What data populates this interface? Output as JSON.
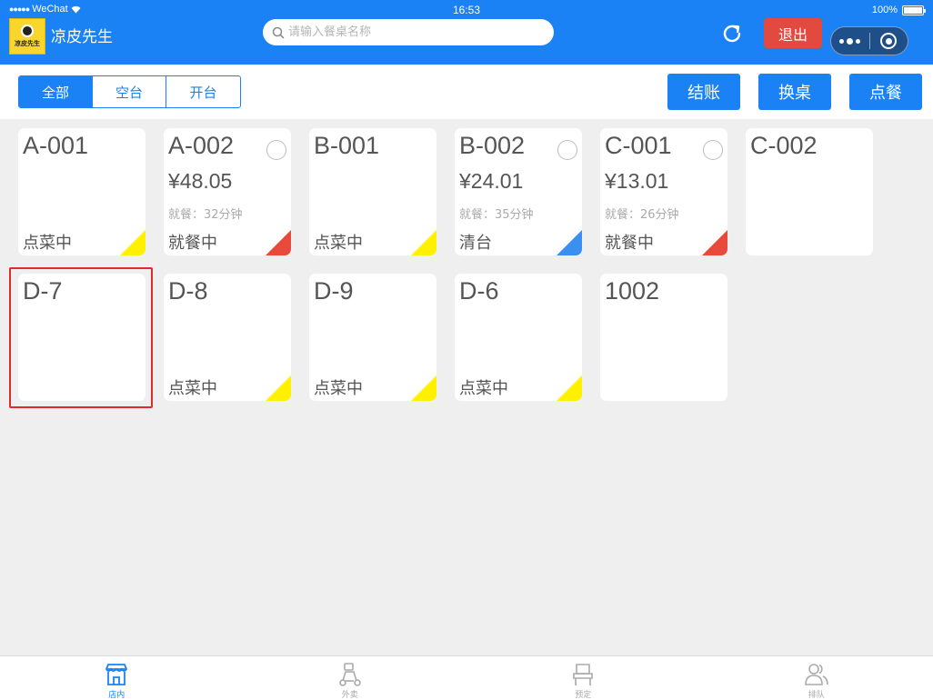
{
  "status_bar": {
    "carrier": "WeChat",
    "time": "16:53",
    "battery": "100%"
  },
  "header": {
    "shop_name": "凉皮先生",
    "logo_text": "凉皮先生",
    "search_placeholder": "请输入餐桌名称",
    "logout_label": "退出"
  },
  "toolbar": {
    "filters": [
      {
        "label": "全部",
        "active": true
      },
      {
        "label": "空台",
        "active": false
      },
      {
        "label": "开台",
        "active": false
      }
    ],
    "actions": [
      "结账",
      "换桌",
      "点餐"
    ]
  },
  "status_colors": {
    "点菜中": "#ffef00",
    "就餐中": "#e84a3c",
    "清台": "#3a8ff0"
  },
  "tables": [
    {
      "name": "A-001",
      "price": "",
      "duration": "",
      "status": "点菜中",
      "radio": false
    },
    {
      "name": "A-002",
      "price": "¥48.05",
      "duration": "就餐：32分钟",
      "status": "就餐中",
      "radio": true
    },
    {
      "name": "B-001",
      "price": "",
      "duration": "",
      "status": "点菜中",
      "radio": false
    },
    {
      "name": "B-002",
      "price": "¥24.01",
      "duration": "就餐：35分钟",
      "status": "清台",
      "radio": true
    },
    {
      "name": "C-001",
      "price": "¥13.01",
      "duration": "就餐：26分钟",
      "status": "就餐中",
      "radio": true
    },
    {
      "name": "C-002",
      "price": "",
      "duration": "",
      "status": "",
      "radio": false
    },
    {
      "name": "D-7",
      "price": "",
      "duration": "",
      "status": "",
      "radio": false,
      "selected": true
    },
    {
      "name": "D-8",
      "price": "",
      "duration": "",
      "status": "点菜中",
      "radio": false
    },
    {
      "name": "D-9",
      "price": "",
      "duration": "",
      "status": "点菜中",
      "radio": false
    },
    {
      "name": "D-6",
      "price": "",
      "duration": "",
      "status": "点菜中",
      "radio": false
    },
    {
      "name": "1002",
      "price": "",
      "duration": "",
      "status": "",
      "radio": false
    }
  ],
  "tabbar": [
    {
      "label": "店内",
      "icon": "store-icon",
      "active": true
    },
    {
      "label": "外卖",
      "icon": "scooter-icon",
      "active": false
    },
    {
      "label": "预定",
      "icon": "chair-icon",
      "active": false
    },
    {
      "label": "排队",
      "icon": "users-icon",
      "active": false
    }
  ],
  "colors": {
    "primary": "#1a82f4",
    "danger": "#e2493f",
    "background": "#efefef"
  }
}
